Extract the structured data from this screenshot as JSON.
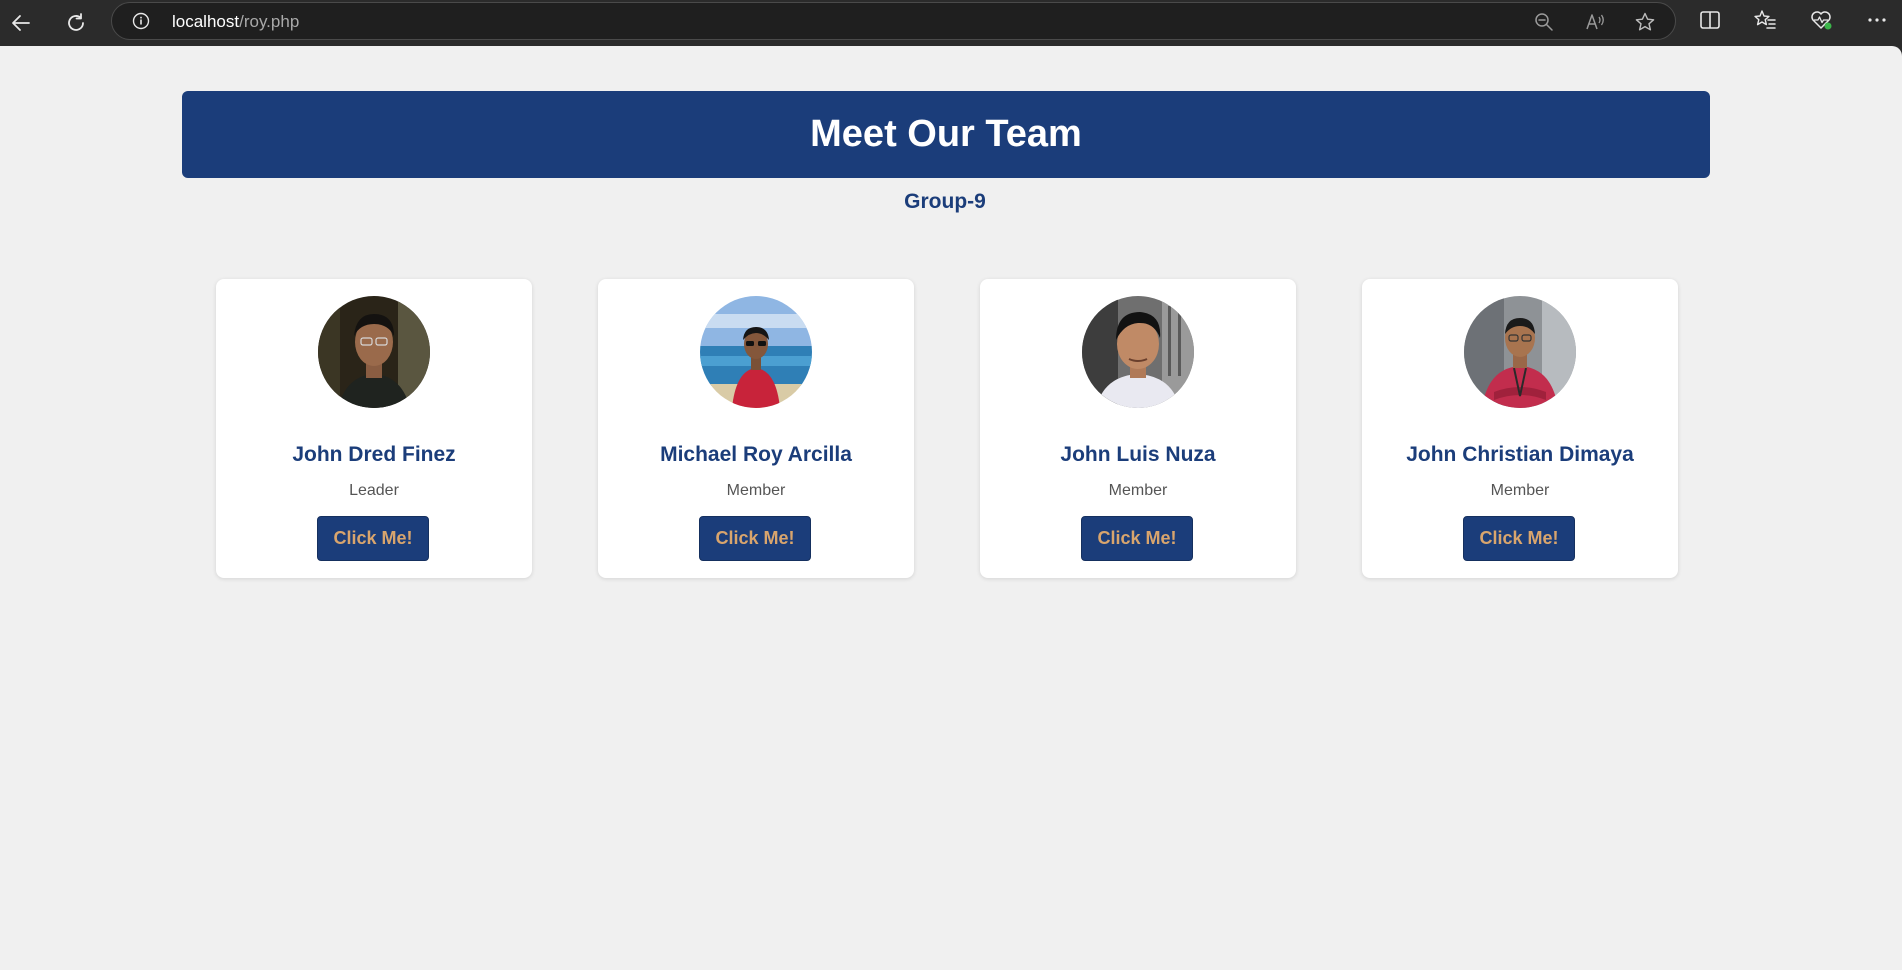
{
  "browser": {
    "url_host": "localhost",
    "url_path": "/roy.php"
  },
  "page": {
    "title": "Meet Our Team",
    "subtitle": "Group-9",
    "members": [
      {
        "name": "John Dred Finez",
        "role": "Leader",
        "button": "Click Me!"
      },
      {
        "name": "Michael Roy Arcilla",
        "role": "Member",
        "button": "Click Me!"
      },
      {
        "name": "John Luis Nuza",
        "role": "Member",
        "button": "Click Me!"
      },
      {
        "name": "John Christian Dimaya",
        "role": "Member",
        "button": "Click Me!"
      }
    ]
  },
  "colors": {
    "primary": "#1b3d7a",
    "button_text": "#d9a56d",
    "page_bg": "#f0f0f0",
    "card_bg": "#ffffff"
  }
}
